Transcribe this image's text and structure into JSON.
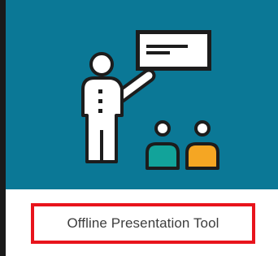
{
  "tile": {
    "title": "Offline Presentation Tool",
    "icon": "presenter-with-audience-icon",
    "colors": {
      "banner": "#0b7896",
      "highlight_border": "#e8141c",
      "audience_left": "#12a39a",
      "audience_right": "#f5a623",
      "outline": "#1c1c1c"
    }
  }
}
